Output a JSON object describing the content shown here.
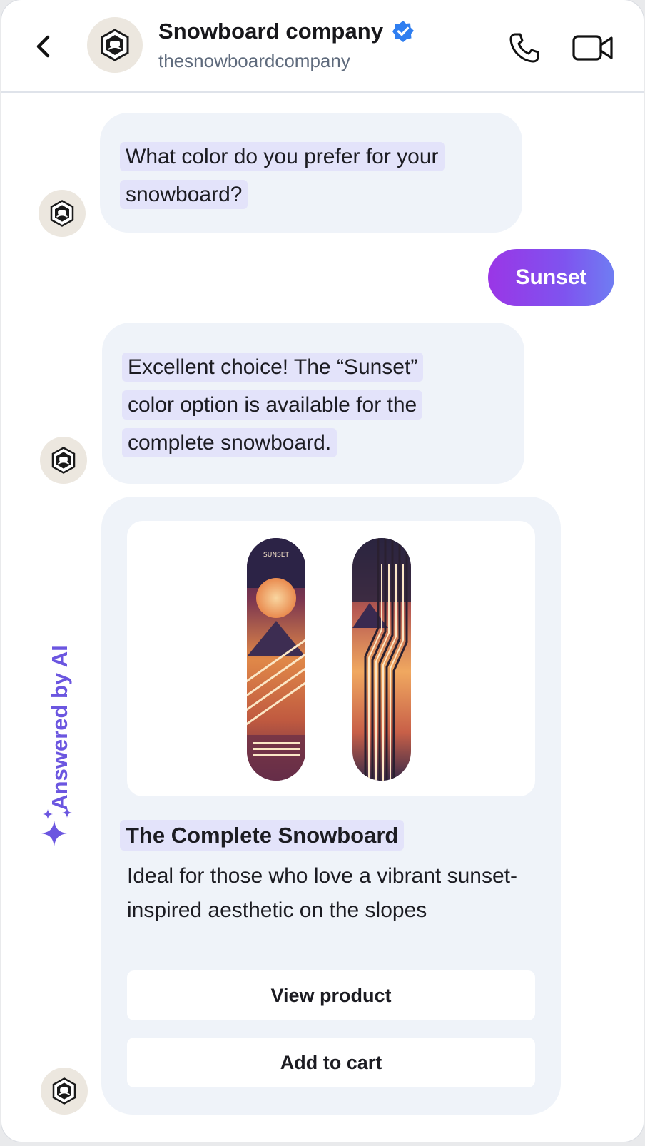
{
  "header": {
    "back_icon": "chevron-left-icon",
    "avatar_icon": "snowboard-company-logo",
    "title": "Snowboard company",
    "verified_icon": "verified-badge-icon",
    "subtitle": "thesnowboardcompany",
    "call_icon": "phone-icon",
    "video_icon": "video-camera-icon"
  },
  "messages": [
    {
      "from": "bot",
      "text_lines": [
        "What color do you prefer for your",
        "snowboard?"
      ]
    },
    {
      "from": "user",
      "text": "Sunset"
    },
    {
      "from": "bot",
      "text_lines": [
        "Excellent choice! The “Sunset”",
        "color option is available for the",
        "complete snowboard."
      ]
    }
  ],
  "product_card": {
    "image_board_text": "SUNSET",
    "title": "The Complete Snowboard",
    "description": "Ideal for those who love a vibrant sunset-inspired aesthetic on the slopes",
    "view_button": "View product",
    "cart_button": "Add to cart",
    "ai_label": "Answered by AI",
    "ai_icon": "sparkles-icon"
  },
  "colors": {
    "accent": "#6b56e0",
    "verified": "#2f7ef0",
    "bubble_bg": "#eff3f9",
    "highlight": "#e3e3fa",
    "user_gradient_start": "#9a36e6",
    "user_gradient_end": "#6f7df2"
  }
}
